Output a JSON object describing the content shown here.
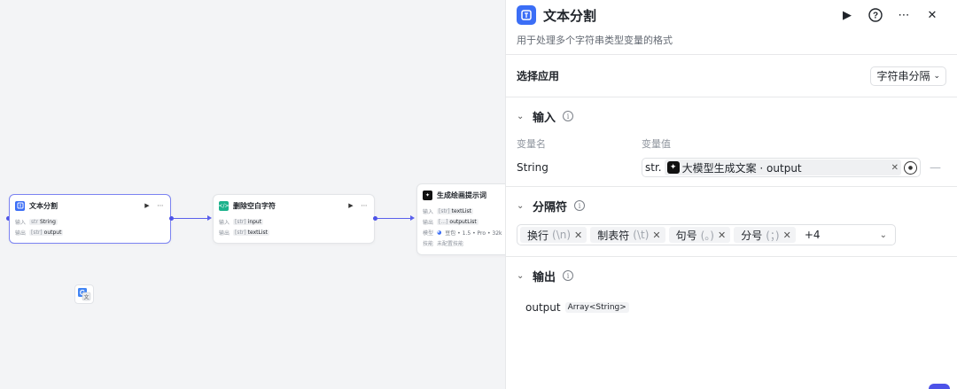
{
  "canvas": {
    "node1": {
      "title": "文本分割",
      "input_label": "输入",
      "input_type": "str",
      "input_value": "String",
      "output_label": "输出",
      "output_type": "[str]",
      "output_value": "output"
    },
    "node2": {
      "title": "删除空白字符",
      "input_label": "输入",
      "input_type": "[str]",
      "input_value": "input",
      "output_label": "输出",
      "output_type": "[str]",
      "output_value": "textList"
    },
    "node3": {
      "title": "生成绘画提示词",
      "input_label": "输入",
      "input_type": "[str]",
      "input_value": "textList",
      "output_label": "输出",
      "output_type": "[...]",
      "output_value": "outputList",
      "model_label": "模型",
      "model_value": "豆包 • 1.5 • Pro • 32k",
      "skill_label": "技能",
      "skill_value": "未配置技能"
    }
  },
  "panel": {
    "title": "文本分割",
    "description": "用于处理多个字符串类型变量的格式",
    "app_label": "选择应用",
    "app_value": "字符串分隔",
    "input_section": "输入",
    "col_name": "变量名",
    "col_value": "变量值",
    "var_name": "String",
    "var_prefix": "str.",
    "var_ref": "大模型生成文案 · output",
    "separator_section": "分隔符",
    "separators": [
      {
        "label": "换行",
        "symbol": "(\\n)"
      },
      {
        "label": "制表符",
        "symbol": "(\\t)"
      },
      {
        "label": "句号",
        "symbol": "(。)"
      },
      {
        "label": "分号",
        "symbol": "(；)"
      }
    ],
    "more_count": "+4",
    "output_section": "输出",
    "output_name": "output",
    "output_type": "Array<String>"
  },
  "colors": {
    "accent": "#4d53e8",
    "brand_blue": "#3b6ef6",
    "code_green": "#1bb28c"
  }
}
